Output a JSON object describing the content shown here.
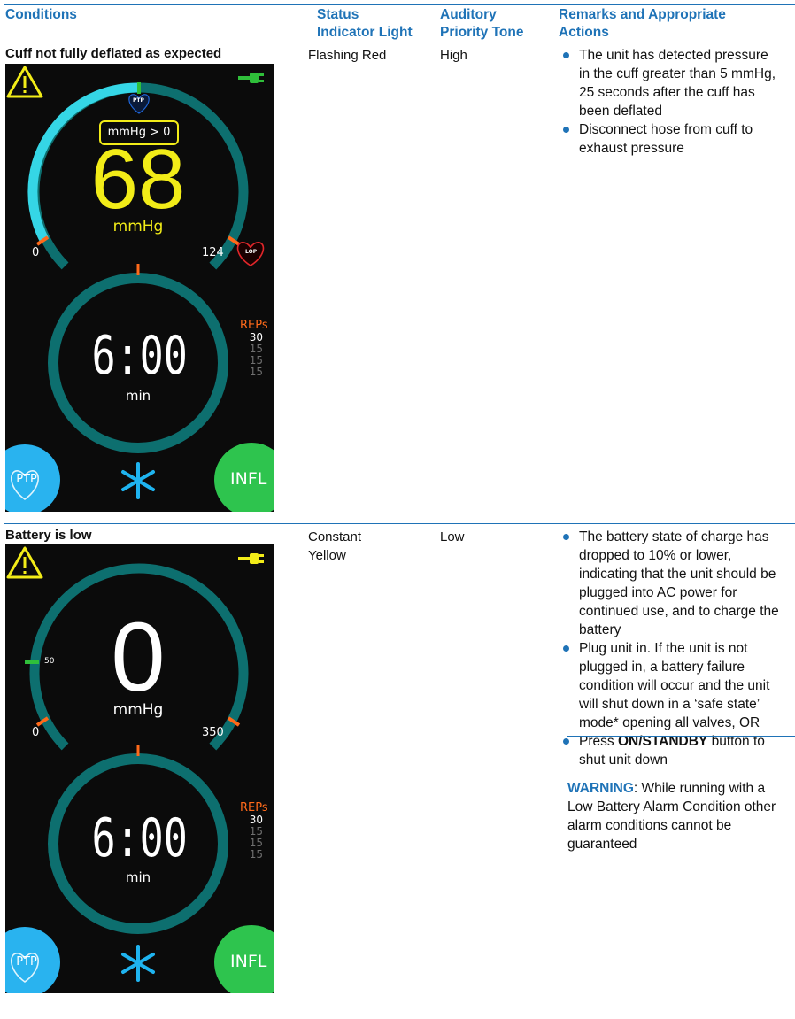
{
  "headers": {
    "conditions": "Conditions",
    "status_line1": "Status",
    "status_line2": "Indicator Light",
    "tone_line1": "Auditory",
    "tone_line2": "Priority Tone",
    "remarks_line1": "Remarks and Appropriate",
    "remarks_line2": "Actions"
  },
  "rows": [
    {
      "condition": "Cuff not fully deflated as expected",
      "status": "Flashing Red",
      "status_line2": "",
      "tone": "High",
      "remarks": [
        "The unit has detected pressure in the cuff greater than 5 mmHg, 25 seconds after the cuff has been deflated",
        "Disconnect hose from cuff to exhaust pressure"
      ],
      "screen": {
        "pressure_badge": "mmHg > 0",
        "pressure_value": "68",
        "pressure_unit": "mmHg",
        "min_label": "0",
        "max_label": "124",
        "ptp_mini": "PTP",
        "lop_mini": "LOP",
        "timer": "6:00",
        "timer_unit": "min",
        "reps_title": "REPs",
        "reps": [
          "30",
          "15",
          "15",
          "15"
        ],
        "ptp_button": "PTP",
        "infl_button": "INFL",
        "colors": {
          "value": "#f2ec18",
          "arc": "#35d6e6",
          "ring": "#0d6f6f"
        }
      }
    },
    {
      "condition": "Battery is low",
      "status": "Constant",
      "status_line2": "Yellow",
      "tone": "Low",
      "remarks": [
        "The battery state of charge has dropped to 10% or lower, indicating that the unit should be plugged into AC power for continued use, and to charge the battery",
        "Plug unit in. If the unit is not plugged in, a battery failure condition will occur and the unit will shut down in a ‘safe state’ mode* opening all valves, OR"
      ],
      "remark3_pre": "Press ",
      "remark3_bold": "ON/STANDBY",
      "remark3_post": " button to shut unit down",
      "warning_label": "WARNING",
      "warning_text": ": While running with a Low Battery Alarm Condition other alarm conditions cannot be guaranteed",
      "screen": {
        "pressure_value": "0",
        "pressure_unit": "mmHg",
        "min_label": "0",
        "max_label": "350",
        "mid_label": "50",
        "timer": "6:00",
        "timer_unit": "min",
        "reps_title": "REPs",
        "reps": [
          "30",
          "15",
          "15",
          "15"
        ],
        "ptp_button": "PTP",
        "infl_button": "INFL",
        "colors": {
          "value": "#ffffff",
          "arc": "#0d6f6f",
          "ring": "#0d6f6f"
        }
      }
    }
  ]
}
